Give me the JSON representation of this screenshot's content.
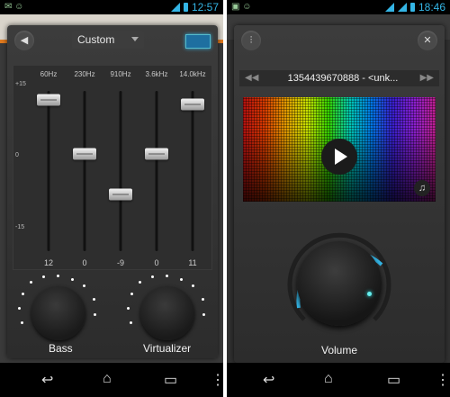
{
  "status_left": {
    "time": "12:57"
  },
  "status_right": {
    "time": "18:46"
  },
  "equalizer": {
    "preset": "Custom",
    "frequencies": [
      "60Hz",
      "230Hz",
      "910Hz",
      "3.6kHz",
      "14.0kHz"
    ],
    "scale": {
      "top": "+15",
      "mid": "0",
      "bottom": "-15"
    },
    "band_values": [
      "12",
      "0",
      "-9",
      "0",
      "11"
    ],
    "bass_label": "Bass",
    "virtualizer_label": "Virtualizer"
  },
  "player": {
    "track_title": "1354439670888  -  <unk...",
    "volume_label": "Volume"
  },
  "colors": {
    "accent": "#34b5e5"
  }
}
